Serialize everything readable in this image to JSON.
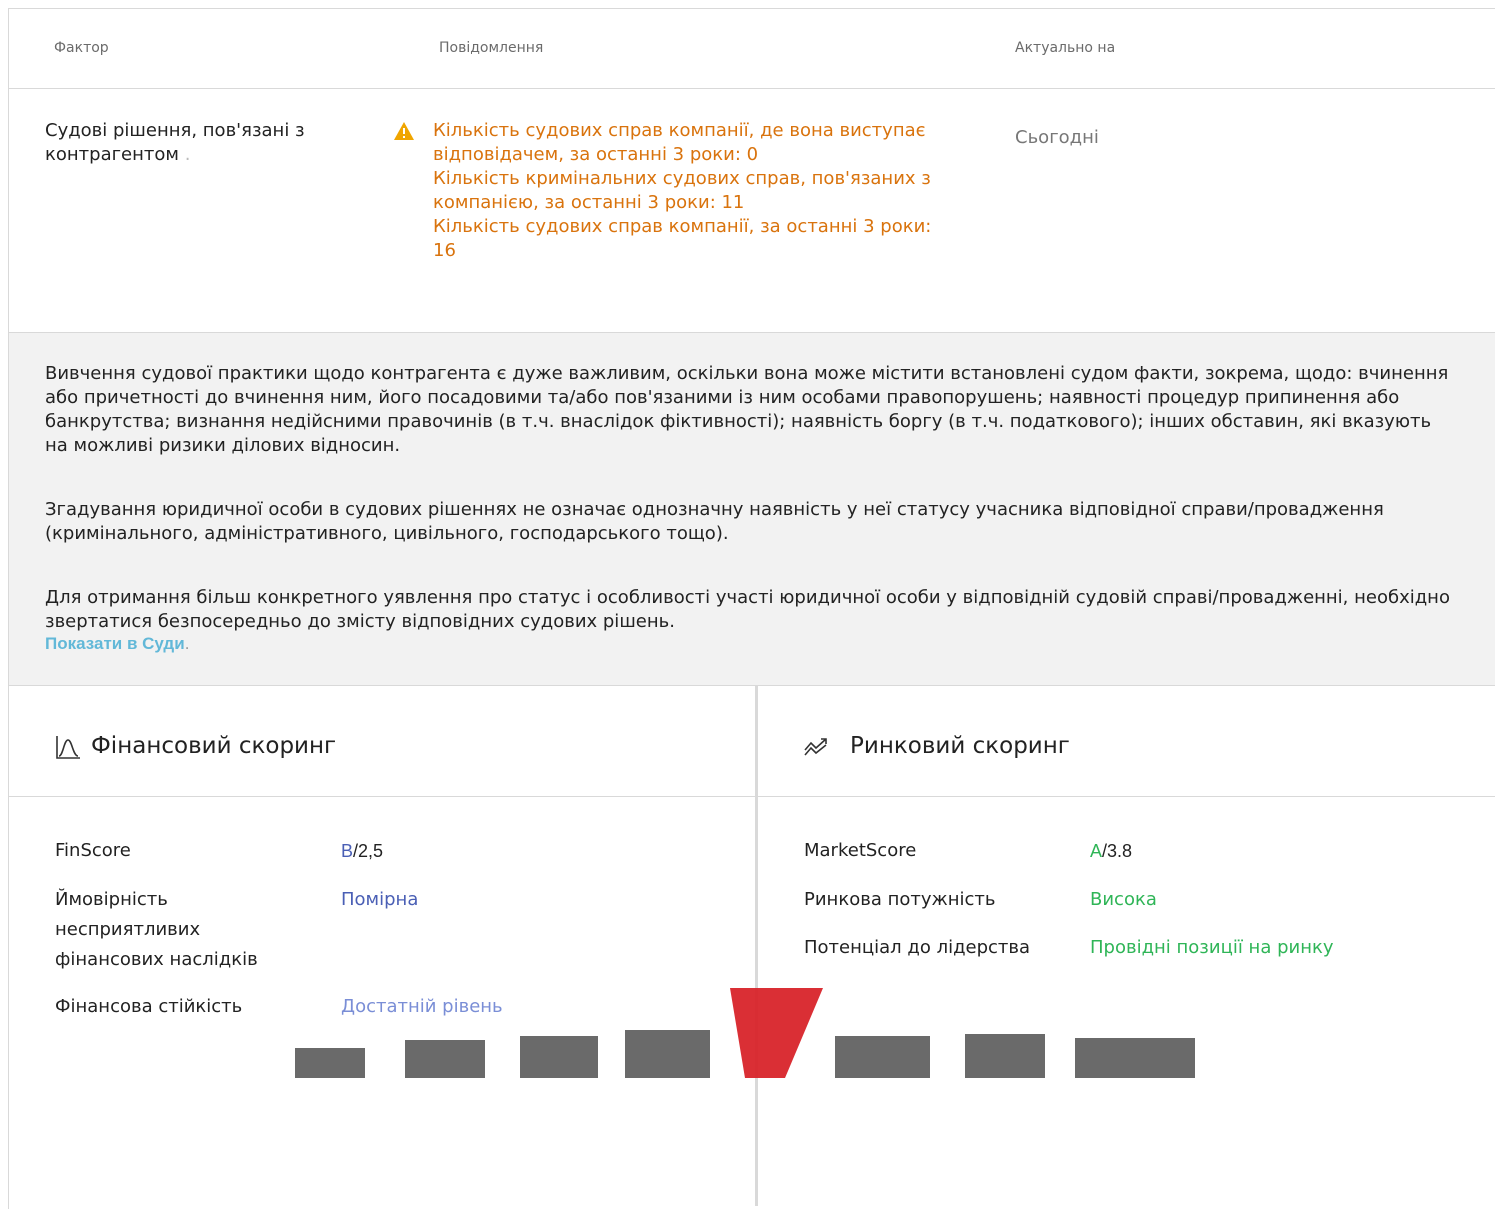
{
  "table": {
    "headers": {
      "factor": "Фактор",
      "message": "Повідомлення",
      "date": "Актуально на"
    },
    "row": {
      "factor": "Судові рішення, пов'язані з контрагентом",
      "factor_dot": ".",
      "messages": [
        "Кількість судових справ компанії, де вона виступає відповідачем, за останні 3 роки: 0",
        "Кількість кримінальних судових справ, пов'язаних з компанією, за останні 3 роки: 11",
        "Кількість судових справ компанії, за останні 3 роки: 16"
      ],
      "date": "Сьогодні"
    }
  },
  "note": {
    "paragraphs": [
      "Вивчення судової практики щодо контрагента є дуже важливим, оскільки вона може містити встановлені судом факти, зокрема, щодо: вчинення або причетності до вчинення ним, його посадовими та/або пов'язаними із ним особами правопорушень; наявності процедур припинення або банкрутства; визнання недійсними правочинів (в т.ч. внаслідок фіктивності); наявність боргу (в т.ч. податкового); інших обставин, які вказують на можливі ризики ділових відносин.",
      "Згадування юридичної особи в судових рішеннях не означає однозначну наявність у неї статусу учасника відповідної справи/провадження (кримінального, адміністративного, цивільного, господарського тощо).",
      "Для отримання більш конкретного уявлення про статус і особливості участі юридичної особи у відповідній судовій справі/провадженні, необхідно звертатися безпосередньо до змісту відповідних судових рішень."
    ],
    "link": "Показати в Суди",
    "link_dot": "."
  },
  "financial": {
    "title": "Фінансовий скоринг",
    "icon": "bell-curve-icon",
    "rows": [
      {
        "label": "FinScore",
        "grade": "B",
        "score": "/2,5"
      },
      {
        "label": "Ймовірність несприятливих фінансових наслідків",
        "value": "Помірна"
      },
      {
        "label": "Фінансова стійкість",
        "value": "Достатній рівень"
      }
    ]
  },
  "market": {
    "title": "Ринковий скоринг",
    "icon": "trend-arrows-icon",
    "rows": [
      {
        "label": "MarketScore",
        "grade": "A",
        "score": "/3.8"
      },
      {
        "label": "Ринкова потужність",
        "value": "Висока"
      },
      {
        "label": "Потенціал до лідерства",
        "value": "Провідні позиції на ринку"
      }
    ]
  },
  "colors": {
    "warning": "#d9730d",
    "link": "#62b8d8",
    "finance_accent": "#4a5fb5",
    "market_accent": "#2fb557",
    "watermark_red": "#d8242a"
  }
}
